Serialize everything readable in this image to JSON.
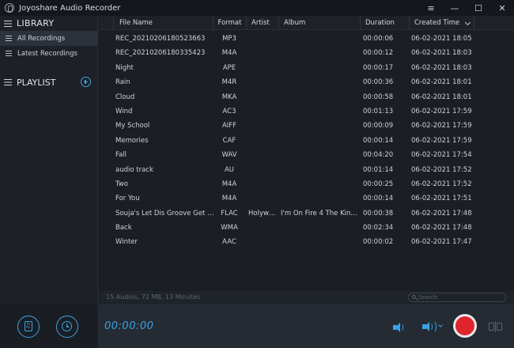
{
  "window": {
    "title": "Joyoshare Audio Recorder",
    "controls": [
      "≡",
      "—",
      "☐",
      "✕"
    ]
  },
  "sidebar": {
    "library_label": "LIBRARY",
    "items": [
      {
        "label": "All Recordings",
        "active": true
      },
      {
        "label": "Latest Recordings",
        "active": false
      }
    ],
    "playlist_label": "PLAYLIST"
  },
  "table": {
    "columns": {
      "file_name": "File Name",
      "format": "Format",
      "artist": "Artist",
      "album": "Album",
      "duration": "Duration",
      "created_time": "Created Time"
    },
    "rows": [
      {
        "name": "REC_20210206180523663",
        "format": "MP3",
        "artist": "",
        "album": "",
        "duration": "00:00:06",
        "created": "06-02-2021 18:05"
      },
      {
        "name": "REC_20210206180335423",
        "format": "M4A",
        "artist": "",
        "album": "",
        "duration": "00:00:12",
        "created": "06-02-2021 18:03"
      },
      {
        "name": "Night",
        "format": "APE",
        "artist": "",
        "album": "",
        "duration": "00:00:17",
        "created": "06-02-2021 18:03"
      },
      {
        "name": "Rain",
        "format": "M4R",
        "artist": "",
        "album": "",
        "duration": "00:00:36",
        "created": "06-02-2021 18:01"
      },
      {
        "name": "Cloud",
        "format": "MKA",
        "artist": "",
        "album": "",
        "duration": "00:00:58",
        "created": "06-02-2021 18:01"
      },
      {
        "name": "Wind",
        "format": "AC3",
        "artist": "",
        "album": "",
        "duration": "00:01:13",
        "created": "06-02-2021 17:59"
      },
      {
        "name": "My School",
        "format": "AIFF",
        "artist": "",
        "album": "",
        "duration": "00:00:09",
        "created": "06-02-2021 17:59"
      },
      {
        "name": "Memories",
        "format": "CAF",
        "artist": "",
        "album": "",
        "duration": "00:00:14",
        "created": "06-02-2021 17:59"
      },
      {
        "name": "Fall",
        "format": "WAV",
        "artist": "",
        "album": "",
        "duration": "00:04:20",
        "created": "06-02-2021 17:54"
      },
      {
        "name": "audio track",
        "format": "AU",
        "artist": "",
        "album": "",
        "duration": "00:01:14",
        "created": "06-02-2021 17:52"
      },
      {
        "name": "Two",
        "format": "M4A",
        "artist": "",
        "album": "",
        "duration": "00:00:25",
        "created": "06-02-2021 17:52"
      },
      {
        "name": "For You",
        "format": "M4A",
        "artist": "",
        "album": "",
        "duration": "00:00:14",
        "created": "06-02-2021 17:51"
      },
      {
        "name": "Souja's Let Dis Groove Get U...",
        "format": "FLAC",
        "artist": "Holywar...",
        "album": "I'm On Fire 4 The King ...",
        "duration": "00:00:38",
        "created": "06-02-2021 17:48"
      },
      {
        "name": "Back",
        "format": "WMA",
        "artist": "",
        "album": "",
        "duration": "00:02:34",
        "created": "06-02-2021 17:48"
      },
      {
        "name": "Winter",
        "format": "AAC",
        "artist": "",
        "album": "",
        "duration": "00:00:02",
        "created": "06-02-2021 17:47"
      }
    ]
  },
  "status": {
    "summary": "15 Audios, 72 MB, 13 Minutes",
    "search_placeholder": "Search"
  },
  "recorder": {
    "timer": "00:00:00"
  },
  "colors": {
    "accent": "#3aa3e6",
    "record": "#e0242c",
    "background": "#1b1f24"
  },
  "icons": {
    "logo": "microphone-logo-icon",
    "library": "hamburger-icon",
    "playlist_add": "plus-circle-icon",
    "bottom_left": [
      "music-file-icon",
      "alarm-clock-icon"
    ],
    "system_audio": "speaker-icon",
    "microphone_audio": "speaker-waves-icon",
    "record": "record-icon",
    "split": "split-view-icon"
  }
}
